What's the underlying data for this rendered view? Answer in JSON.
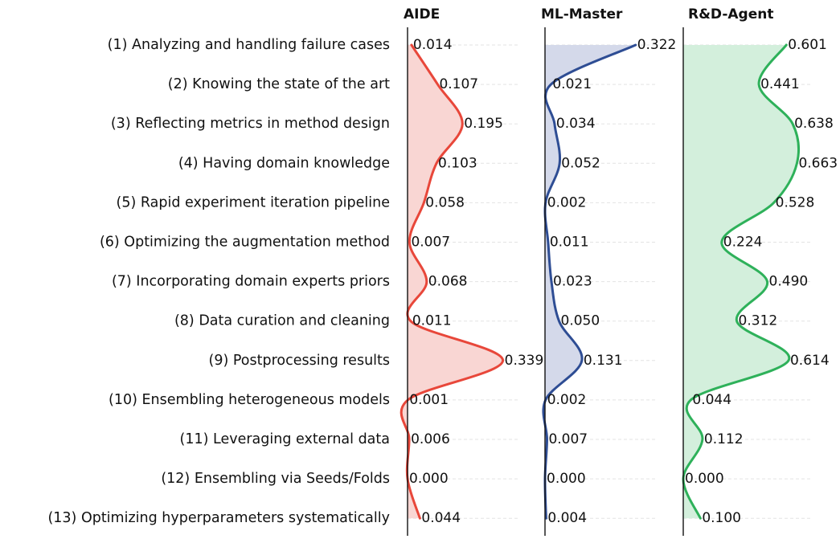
{
  "chart_data": {
    "type": "area",
    "orientation": "horizontal",
    "categories": [
      "(1) Analyzing and handling failure cases",
      "(2) Knowing the state of the art",
      "(3) Reflecting metrics in method design",
      "(4) Having domain knowledge",
      "(5) Rapid experiment iteration pipeline",
      "(6) Optimizing the augmentation method",
      "(7) Incorporating domain experts priors",
      "(8) Data curation and cleaning",
      "(9) Postprocessing results",
      "(10) Ensembling heterogeneous models",
      "(11) Leveraging external data",
      "(12) Ensembling via Seeds/Folds",
      "(13) Optimizing hyperparameters systematically"
    ],
    "series": [
      {
        "name": "AIDE",
        "color": "#e8473a",
        "fill": "#f9d6d3",
        "values": [
          0.014,
          0.107,
          0.195,
          0.103,
          0.058,
          0.007,
          0.068,
          0.011,
          0.339,
          0.001,
          0.006,
          0.0,
          0.044
        ],
        "labels": [
          "0.014",
          "0.107",
          "0.195",
          "0.103",
          "0.058",
          "0.007",
          "0.068",
          "0.011",
          "0.339",
          "0.001",
          "0.006",
          "0.000",
          "0.044"
        ]
      },
      {
        "name": "ML-Master",
        "color": "#2e4d94",
        "fill": "#d4d9ea",
        "values": [
          0.322,
          0.021,
          0.034,
          0.052,
          0.002,
          0.011,
          0.023,
          0.05,
          0.131,
          0.002,
          0.007,
          0.0,
          0.004
        ],
        "labels": [
          "0.322",
          "0.021",
          "0.034",
          "0.052",
          "0.002",
          "0.011",
          "0.023",
          "0.050",
          "0.131",
          "0.002",
          "0.007",
          "0.000",
          "0.004"
        ]
      },
      {
        "name": "R&D-Agent",
        "color": "#2eb15a",
        "fill": "#d3efdc",
        "values": [
          0.601,
          0.441,
          0.638,
          0.663,
          0.528,
          0.224,
          0.49,
          0.312,
          0.614,
          0.044,
          0.112,
          0.0,
          0.1
        ],
        "labels": [
          "0.601",
          "0.441",
          "0.638",
          "0.663",
          "0.528",
          "0.224",
          "0.490",
          "0.312",
          "0.614",
          "0.044",
          "0.112",
          "0.000",
          "0.100"
        ]
      }
    ],
    "grid": "dashed horizontal"
  }
}
